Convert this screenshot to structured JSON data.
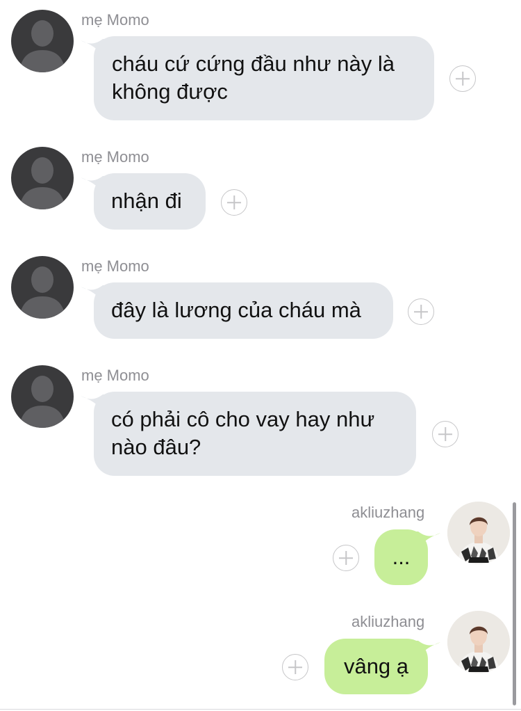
{
  "messages": [
    {
      "sender": "mẹ Momo",
      "text": "cháu cứ cứng đầu như này là không được",
      "direction": "incoming"
    },
    {
      "sender": "mẹ Momo",
      "text": "nhận đi",
      "direction": "incoming"
    },
    {
      "sender": "mẹ Momo",
      "text": "đây là lương của cháu mà",
      "direction": "incoming"
    },
    {
      "sender": "mẹ Momo",
      "text": "có phải cô cho vay hay như nào đâu?",
      "direction": "incoming"
    },
    {
      "sender": "akliuzhang",
      "text": "...",
      "direction": "outgoing"
    },
    {
      "sender": "akliuzhang",
      "text": "vâng ạ",
      "direction": "outgoing"
    }
  ],
  "colors": {
    "incoming_bubble": "#e4e7eb",
    "outgoing_bubble": "#c7ee99",
    "sender_name": "#8e8e93",
    "default_avatar": "#3a3a3c"
  },
  "icons": {
    "default_avatar": "person-silhouette-icon",
    "reaction": "plus-circle-icon"
  }
}
